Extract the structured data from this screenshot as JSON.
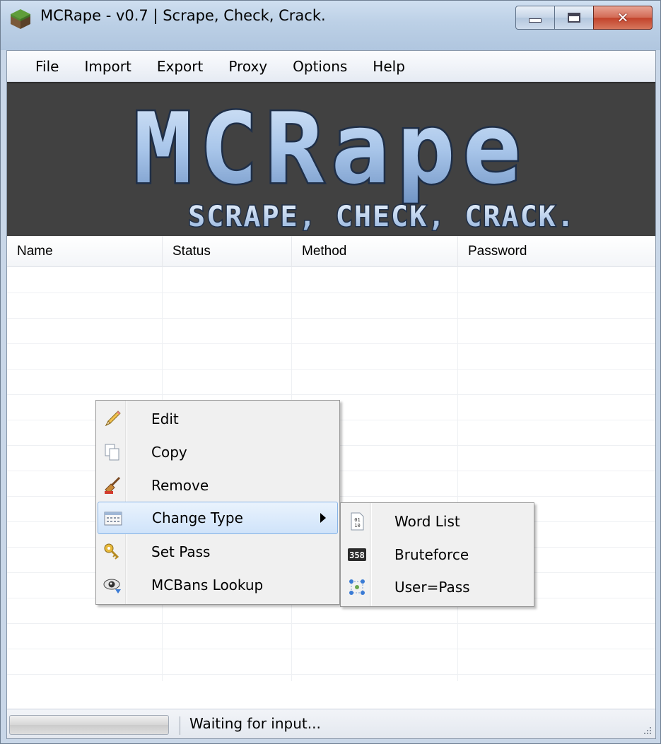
{
  "window": {
    "title": "MCRape - v0.7 | Scrape, Check, Crack."
  },
  "menubar": {
    "items": [
      "File",
      "Import",
      "Export",
      "Proxy",
      "Options",
      "Help"
    ]
  },
  "banner": {
    "logo_text": "MCRape",
    "tagline": "SCRAPE, CHECK, CRACK."
  },
  "listview": {
    "columns": [
      "Name",
      "Status",
      "Method",
      "Password"
    ],
    "rows": []
  },
  "context_menu": {
    "items": [
      {
        "label": "Edit",
        "icon": "pencil-icon"
      },
      {
        "label": "Copy",
        "icon": "copy-icon"
      },
      {
        "label": "Remove",
        "icon": "broom-icon"
      },
      {
        "label": "Change Type",
        "icon": "grid-icon",
        "has_submenu": true,
        "highlighted": true
      },
      {
        "label": "Set Pass",
        "icon": "key-icon"
      },
      {
        "label": "MCBans Lookup",
        "icon": "eye-icon"
      }
    ]
  },
  "submenu": {
    "items": [
      {
        "label": "Word List",
        "icon": "binary-file-icon"
      },
      {
        "label": "Bruteforce",
        "icon": "counter-icon",
        "icon_text": "358"
      },
      {
        "label": "User=Pass",
        "icon": "nodes-icon"
      }
    ]
  },
  "statusbar": {
    "text": "Waiting for input...",
    "progress": 0
  },
  "colors": {
    "banner_bg": "#414141",
    "logo_fill": "#a9c6ea",
    "highlight": "#cfe3fa",
    "close_button": "#c2422a"
  }
}
